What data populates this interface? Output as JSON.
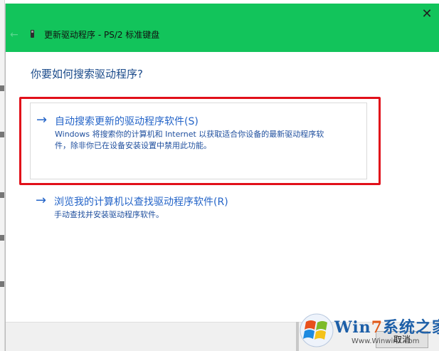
{
  "window": {
    "title": "更新驱动程序 - PS/2 标准键盘",
    "close_icon": "close-icon",
    "back_icon": "back-arrow-icon"
  },
  "question": "你要如何搜索驱动程序?",
  "options": [
    {
      "icon": "arrow-right-icon",
      "arrow": "→",
      "title": "自动搜索更新的驱动程序软件(S)",
      "desc_line1": "Windows 将搜索你的计算机和 Internet 以获取适合你设备的最新驱动程序软",
      "desc_line2": "件，除非你已在设备安装设置中禁用此功能。"
    },
    {
      "icon": "arrow-right-icon",
      "arrow": "→",
      "title": "浏览我的计算机以查找驱动程序软件(R)",
      "desc_line1": "手动查找并安装驱动程序软件。"
    }
  ],
  "footer": {
    "cancel_label": "取消"
  },
  "watermark": {
    "brand_prefix": "Win",
    "brand_seven": "7",
    "brand_suffix": "系统之家",
    "url": "Www.Winwin7.com"
  },
  "colors": {
    "titlebar": "#12c45b",
    "link": "#2464c8",
    "highlight": "#e1101a"
  }
}
